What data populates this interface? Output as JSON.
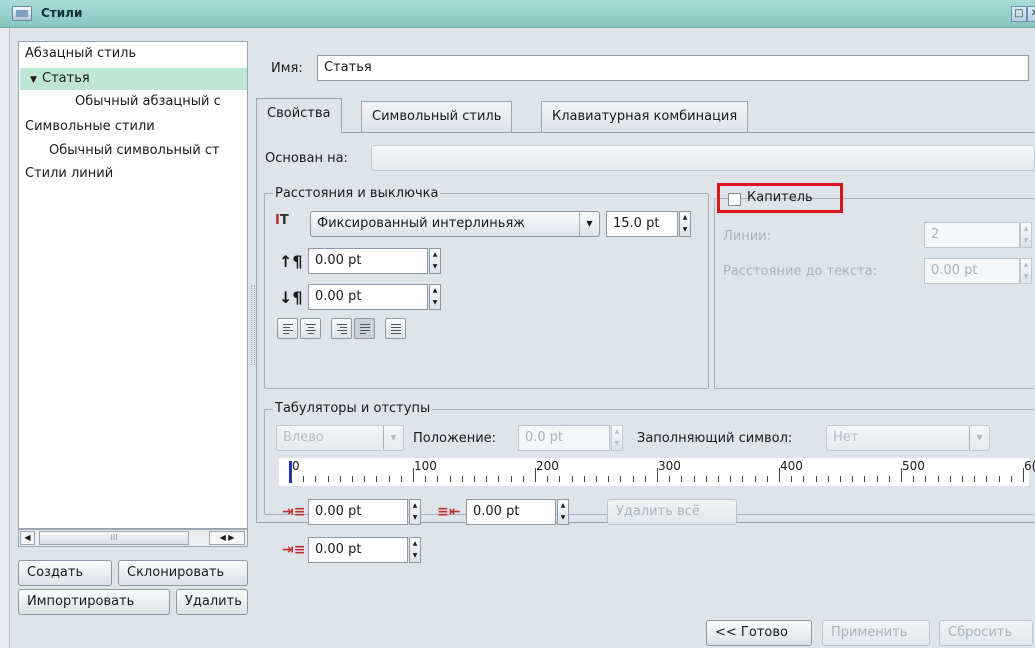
{
  "window": {
    "title": "Стили"
  },
  "tree": {
    "items": [
      {
        "label": "Абзацный стиль",
        "indent": 0
      },
      {
        "label": "Статья",
        "indent": 1,
        "expanded": true,
        "selected": true
      },
      {
        "label": "Обычный абзацный с",
        "indent": 2
      },
      {
        "label": "Символьные стили",
        "indent": 0
      },
      {
        "label": "Обычный символьный ст",
        "indent": 1
      },
      {
        "label": "Стили линий",
        "indent": 0
      }
    ]
  },
  "scrollbar": {
    "thumb_label": "III",
    "left_arrow": "◀",
    "right_arrow": "◀ ▶"
  },
  "left_buttons": {
    "create": "Создать",
    "clone": "Склонировать",
    "import": "Импортировать",
    "delete": "Удалить"
  },
  "name": {
    "label": "Имя:",
    "value": "Статья"
  },
  "tabs": [
    {
      "label": "Свойства",
      "active": true
    },
    {
      "label": "Символьный стиль",
      "active": false
    },
    {
      "label": "Клавиатурная комбинация",
      "active": false
    }
  ],
  "based_on": {
    "label": "Основан на:",
    "value": ""
  },
  "spacing": {
    "title": "Расстояния и выключка",
    "line_spacing_mode": "Фиксированный интерлиньяж",
    "line_spacing_value": "15.0 pt",
    "space_above": "0.00 pt",
    "space_below": "0.00 pt",
    "alignment_active_index": 3
  },
  "dropcaps": {
    "checkbox_label": "Капитель",
    "checked": false,
    "lines_label": "Линии:",
    "lines_value": "2",
    "distance_label": "Расстояние до текста:",
    "distance_value": "0.00 pt"
  },
  "tabs_indents": {
    "title": "Табуляторы и отступы",
    "tab_type": "Влево",
    "position_label": "Положение:",
    "position_value": "0.0 pt",
    "fill_label": "Заполняющий символ:",
    "fill_value": "Нет",
    "ruler_labels": [
      "0",
      "100",
      "200",
      "300",
      "400",
      "500",
      "6("
    ],
    "first_line_indent": "0.00 pt",
    "right_indent": "0.00 pt",
    "left_indent": "0.00 pt",
    "delete_all": "Удалить всё"
  },
  "footer": {
    "done": "<< Готово",
    "apply": "Применить",
    "reset": "Сбросить"
  },
  "colors": {
    "titlebar": "#86c6be",
    "selection": "#bfe6d5",
    "highlight_box": "#e0121c",
    "ruler_marker": "#1c2fe0"
  }
}
